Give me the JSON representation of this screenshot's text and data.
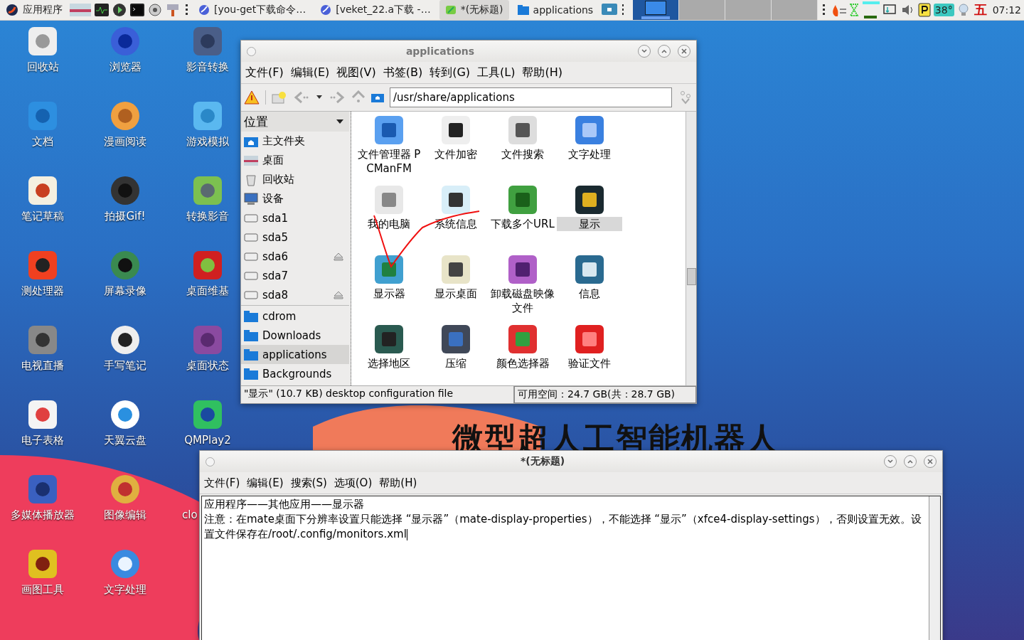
{
  "panel": {
    "menu_label": "应用程序",
    "tasks": [
      {
        "label": "[you-get下载命令…",
        "selected": false
      },
      {
        "label": "[veket_22.a下载 -…",
        "selected": false
      },
      {
        "label": "*(无标题)",
        "selected": true
      },
      {
        "label": "applications",
        "selected": false
      }
    ],
    "workspaces": [
      {
        "selected": true
      },
      {
        "selected": false
      },
      {
        "selected": false
      },
      {
        "selected": false
      }
    ],
    "temperature": "38°",
    "input_method": "五",
    "clock": "07:12"
  },
  "desktop": {
    "wallpaper_text": "微型超人工智能机器人",
    "icons": [
      "回收站",
      "浏览器",
      "影音转换",
      "文档",
      "漫画阅读",
      "游戏模拟",
      "笔记草稿",
      "拍摄Gif!",
      "转换影音",
      "测处理器",
      "屏幕录像",
      "桌面维基",
      "电视直播",
      "手写笔记",
      "桌面状态",
      "电子表格",
      "天翼云盘",
      "QMPlay2",
      "多媒体播放器",
      "图像编辑",
      "clo",
      "画图工具",
      "文字处理"
    ]
  },
  "file_manager": {
    "title": "applications",
    "menu": [
      "文件(F)",
      "编辑(E)",
      "视图(V)",
      "书签(B)",
      "转到(G)",
      "工具(L)",
      "帮助(H)"
    ],
    "path": "/usr/share/applications",
    "sidebar_title": "位置",
    "places": [
      {
        "label": "主文件夹",
        "kind": "home",
        "selected": false
      },
      {
        "label": "桌面",
        "kind": "desktop",
        "selected": false
      },
      {
        "label": "回收站",
        "kind": "trash",
        "selected": false
      },
      {
        "label": "设备",
        "kind": "computer",
        "selected": false
      },
      {
        "label": "sda1",
        "kind": "drive",
        "eject": false,
        "selected": false
      },
      {
        "label": "sda5",
        "kind": "drive",
        "eject": false,
        "selected": false
      },
      {
        "label": "sda6",
        "kind": "drive",
        "eject": true,
        "selected": false
      },
      {
        "label": "sda7",
        "kind": "drive",
        "eject": false,
        "selected": false
      },
      {
        "label": "sda8",
        "kind": "drive",
        "eject": true,
        "selected": false
      },
      {
        "label": "cdrom",
        "kind": "folder",
        "selected": false
      },
      {
        "label": "Downloads",
        "kind": "folder",
        "selected": false
      },
      {
        "label": "applications",
        "kind": "folder",
        "selected": true
      },
      {
        "label": "Backgrounds",
        "kind": "folder",
        "selected": false
      }
    ],
    "items": [
      {
        "label": "文件管理器 PCManFM",
        "selected": false
      },
      {
        "label": "文件加密",
        "selected": false
      },
      {
        "label": "文件搜索",
        "selected": false
      },
      {
        "label": "文字处理",
        "selected": false
      },
      {
        "label": "我的电脑",
        "selected": false
      },
      {
        "label": "系统信息",
        "selected": false
      },
      {
        "label": "下载多个URL",
        "selected": false
      },
      {
        "label": "显示",
        "selected": true
      },
      {
        "label": "显示器",
        "selected": false
      },
      {
        "label": "显示桌面",
        "selected": false
      },
      {
        "label": "卸载磁盘映像文件",
        "selected": false
      },
      {
        "label": "信息",
        "selected": false
      },
      {
        "label": "选择地区",
        "selected": false
      },
      {
        "label": "压缩",
        "selected": false
      },
      {
        "label": "颜色选择器",
        "selected": false
      },
      {
        "label": "验证文件",
        "selected": false
      }
    ],
    "status": "\"显示\" (10.7 KB) desktop configuration file",
    "free_space": "可用空间：24.7 GB(共：28.7 GB)"
  },
  "editor": {
    "title": "*(无标题)",
    "menu": [
      "文件(F)",
      "编辑(E)",
      "搜索(S)",
      "选项(O)",
      "帮助(H)"
    ],
    "lines": [
      "应用程序——其他应用——显示器",
      "注意：在mate桌面下分辨率设置只能选择 “显示器”（mate-display-properties），不能选择 “显示”（xfce4-display-settings），否则设置无效。设置文件保存在/root/.config/monitors.xml"
    ]
  }
}
